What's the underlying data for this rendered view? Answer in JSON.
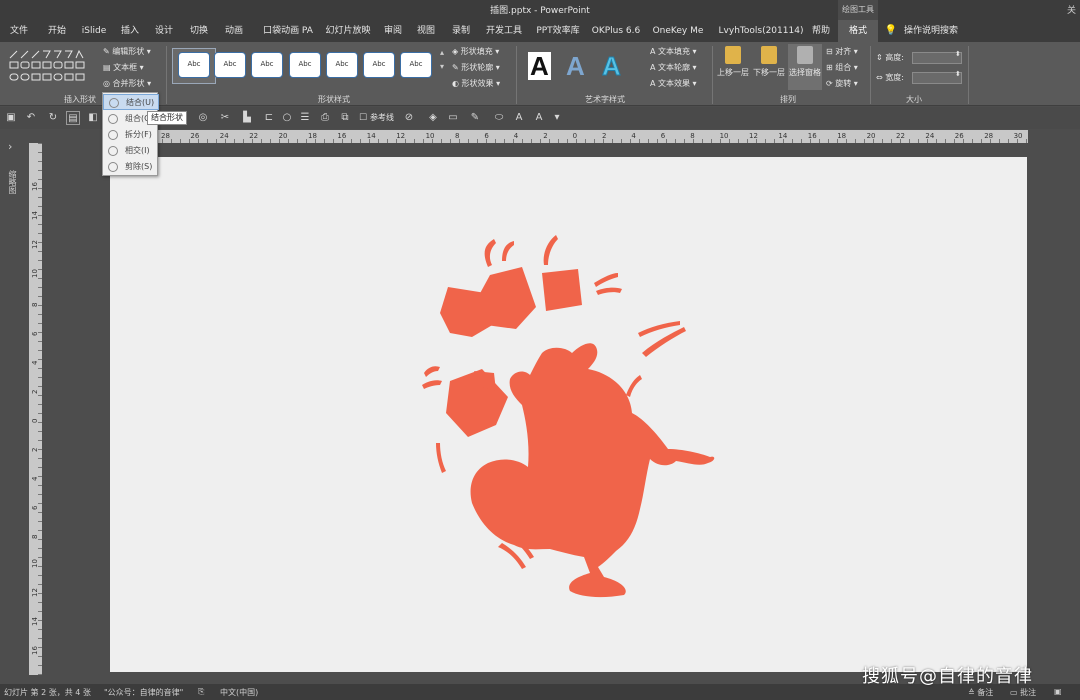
{
  "window": {
    "title": "插图.pptx  -  PowerPoint",
    "context_tab_group": "绘图工具",
    "close_hint": "关"
  },
  "tabs": [
    "文件",
    "开始",
    "iSlide",
    "插入",
    "设计",
    "切换",
    "动画",
    "口袋动画 PA",
    "幻灯片放映",
    "审阅",
    "视图",
    "录制",
    "开发工具",
    "PPT效率库",
    "OKPlus 6.6",
    "OneKey Me",
    "LvyhTools(201114)",
    "帮助",
    "格式"
  ],
  "active_tab": "格式",
  "search_tip": "操作说明搜索",
  "ribbon": {
    "insert_shapes": {
      "label": "插入形状",
      "edit_shape": "编辑形状 ▾",
      "text_box": "文本框 ▾",
      "merge_shapes": "合并形状 ▾"
    },
    "shape_styles": {
      "label": "形状样式",
      "sample": "Abc",
      "fill": "形状填充 ▾",
      "outline": "形状轮廓 ▾",
      "effects": "形状效果 ▾",
      "swatch_colors": [
        "#ffffff",
        "#ffffff",
        "#ffffff",
        "#ffffff",
        "#ffffff",
        "#ffffff",
        "#ffffff"
      ]
    },
    "wordart_styles": {
      "label": "艺术字样式",
      "glyph": "A",
      "text_fill": "文本填充 ▾",
      "text_outline": "文本轮廓 ▾",
      "text_effects": "文本效果 ▾"
    },
    "arrange": {
      "label": "排列",
      "bring_forward": "上移一层",
      "send_backward": "下移一层",
      "selection_pane": "选择窗格",
      "align": "对齐 ▾",
      "group": "组合 ▾",
      "rotate": "旋转 ▾"
    },
    "size": {
      "label": "大小",
      "height": "高度:",
      "width": "宽度:"
    }
  },
  "qat": {
    "reference_line": "参考线"
  },
  "merge_menu": {
    "items": [
      "结合(U)",
      "组合(C)",
      "拆分(F)",
      "相交(I)",
      "剪除(S)"
    ],
    "highlighted_index": 0,
    "tooltip": "结合形状"
  },
  "ruler": {
    "h_ticks": [
      "28",
      "26",
      "24",
      "22",
      "20",
      "18",
      "16",
      "14",
      "12",
      "10",
      "8",
      "6",
      "4",
      "2",
      "0",
      "2",
      "4",
      "6",
      "8",
      "10",
      "12",
      "14",
      "16",
      "18",
      "20",
      "22",
      "24",
      "26",
      "28",
      "30"
    ],
    "v_ticks": [
      "16",
      "14",
      "12",
      "10",
      "8",
      "6",
      "4",
      "2",
      "0",
      "2",
      "4",
      "6",
      "8",
      "10",
      "12",
      "14",
      "16"
    ]
  },
  "left_panel_label": "缩略图",
  "slide": {
    "background": "#efefef",
    "shape_color": "#f0644a"
  },
  "status": {
    "slide_info": "幻灯片 第 2 张，共 4 张",
    "theme": "\"公众号：自律的音律\"",
    "language": "中文(中国)",
    "notes": "备注",
    "comments": "批注"
  },
  "watermark": "搜狐号@自律的音律",
  "colors": {
    "accent": "#3b6ea5",
    "ribbon_bg": "#5a5a5a",
    "shape": "#f0644a"
  }
}
